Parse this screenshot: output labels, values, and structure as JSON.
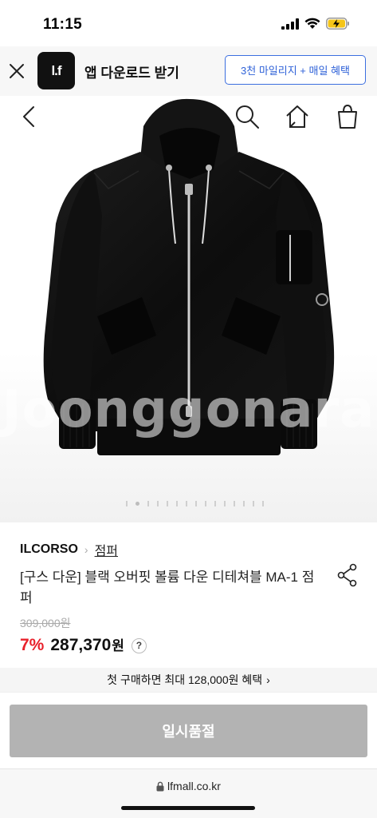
{
  "status_bar": {
    "time": "11:15"
  },
  "app_banner": {
    "logo_text": "l.f",
    "title": "앱 다운로드 받기",
    "cta_label": "3천 마일리지 + 매일 혜택"
  },
  "product_image": {
    "watermark": "Joonggonara",
    "image_count": 16,
    "active_index": 1
  },
  "product": {
    "brand": "ILCORSO",
    "category": "점퍼",
    "name": "[구스 다운] 블랙 오버핏 볼륨 다운 디테쳐블 MA-1 점퍼",
    "original_price": "309,000원",
    "discount": "7%",
    "sale_price": "287,370",
    "currency": "원",
    "help_label": "?"
  },
  "benefit": {
    "text": "첫 구매하면 최대 128,000원 혜택",
    "chevron": "›"
  },
  "purchase": {
    "soldout_label": "일시품절"
  },
  "browser": {
    "url": "lfmall.co.kr"
  },
  "colors": {
    "accent_blue": "#2f62d8",
    "discount_red": "#e8212b",
    "soldout_gray": "#b3b3b3"
  },
  "icons": [
    "signal-icon",
    "wifi-icon",
    "battery-charging-icon",
    "close-icon",
    "back-icon",
    "search-icon",
    "home-icon",
    "shopping-bag-icon",
    "share-icon",
    "lock-icon"
  ]
}
